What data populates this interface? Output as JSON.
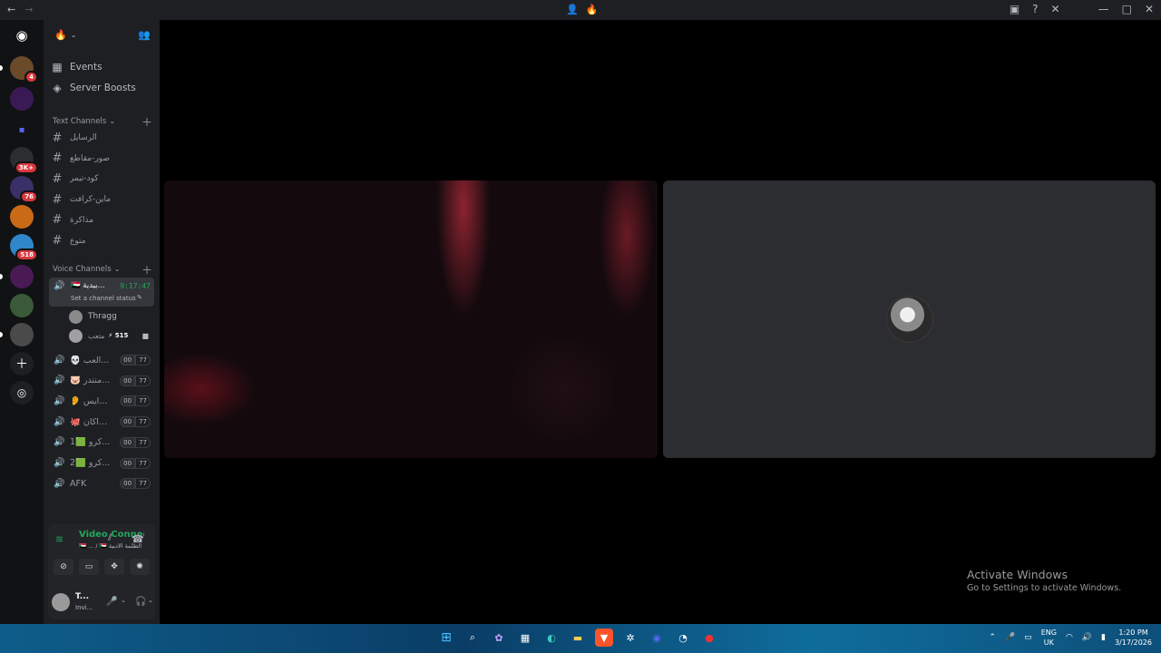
{
  "titlebar": {
    "nav_back": "←",
    "nav_forward": "→"
  },
  "guilds": [
    {
      "badge": "4",
      "color": "#6b4a2a",
      "active": true
    },
    {
      "badge": "",
      "color": "#3a1a55"
    },
    {
      "badge": "",
      "color": "#5865f2",
      "folder": true
    },
    {
      "badge": "3K+",
      "color": "#2b2d31"
    },
    {
      "badge": "76",
      "color": "#3a2f66"
    },
    {
      "badge": "",
      "color": "#c96a17"
    },
    {
      "badge": "518",
      "color": "#2f86c9"
    },
    {
      "badge": "",
      "color": "#4a1a55",
      "active": true
    },
    {
      "badge": "",
      "color": "#3a5a3a"
    },
    {
      "badge": "",
      "color": "#4a4a4a",
      "active": true
    }
  ],
  "server": {
    "name": "🔥"
  },
  "menu": {
    "events": "Events",
    "boosts": "Server Boosts"
  },
  "text_category": "Text Channels",
  "text_channels": [
    "الرسايل",
    "صور-مقاطع",
    "كود-تيمر",
    "ماين-كرافت",
    "مذاكرة",
    "متوع"
  ],
  "voice_category": "Voice Channels",
  "active_voice": {
    "name": "🇸🇩 بيدية...",
    "timer": "9:17:47",
    "status": "Set a channel status",
    "members": [
      {
        "name": "Thragg",
        "extra": ""
      },
      {
        "name": "متعب",
        "extra": "⚡ 515"
      }
    ]
  },
  "voice_channels": [
    {
      "name": "💀 العب...",
      "c1": "00",
      "c2": "77"
    },
    {
      "name": "🐷 منتدر...",
      "c1": "00",
      "c2": "77"
    },
    {
      "name": "👂 ايس...",
      "c1": "00",
      "c2": "77"
    },
    {
      "name": "🐙 اكان...",
      "c1": "00",
      "c2": "77"
    },
    {
      "name": "1🟩 كرو...",
      "c1": "00",
      "c2": "77"
    },
    {
      "name": "2🟩 كرو...",
      "c1": "00",
      "c2": "77"
    },
    {
      "name": "AFK",
      "c1": "00",
      "c2": "77"
    }
  ],
  "voice_panel": {
    "title": "Video Connecte",
    "subtitle": "🇸🇩 ... / 🇸🇩 الطلمة الادبية"
  },
  "user": {
    "name": "T...",
    "status": "Invi..."
  },
  "activate": {
    "title": "Activate Windows",
    "subtitle": "Go to Settings to activate Windows."
  },
  "tray": {
    "lang1": "ENG",
    "lang2": "UK",
    "time": "1:20 PM",
    "date": "3/17/2026"
  },
  "colors": {
    "green": "#23a55a",
    "bg": "#1e1f22"
  }
}
